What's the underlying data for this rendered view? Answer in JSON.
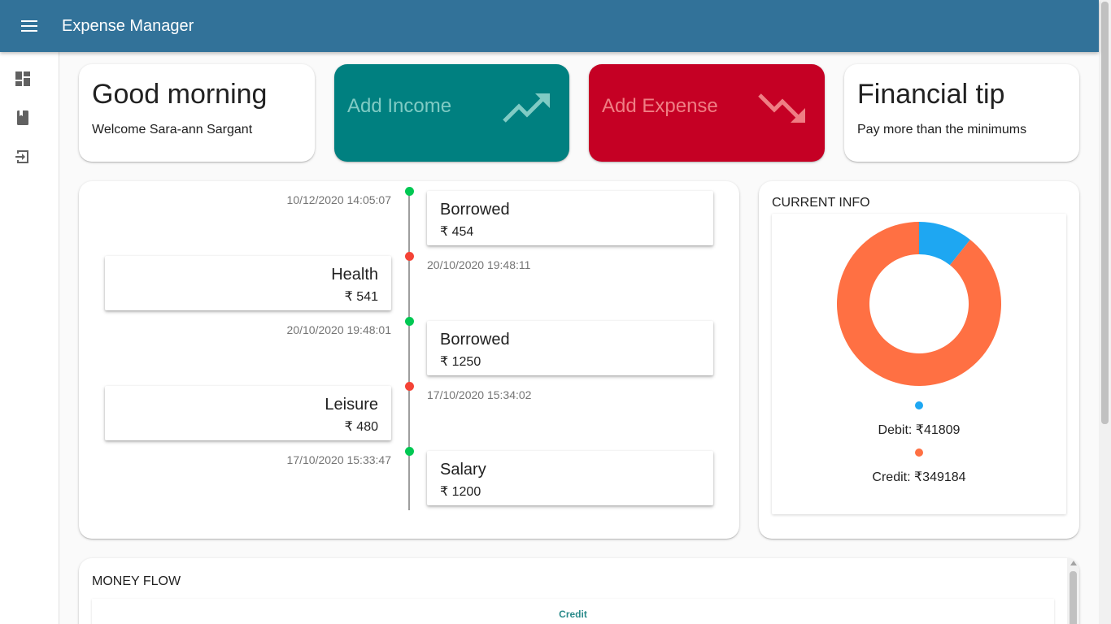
{
  "app": {
    "title": "Expense Manager"
  },
  "drawer": {
    "items": [
      {
        "icon": "dashboard-icon"
      },
      {
        "icon": "book-icon"
      },
      {
        "icon": "logout-icon"
      }
    ]
  },
  "greeting": {
    "title": "Good morning",
    "subtitle": "Welcome Sara-ann Sargant"
  },
  "actions": {
    "income": {
      "label": "Add Income",
      "icon": "trending-up-icon",
      "bg": "#008080",
      "fg": "#80cbc4"
    },
    "expense": {
      "label": "Add Expense",
      "icon": "trending-down-icon",
      "bg": "#c50024",
      "fg": "#ef7e84"
    }
  },
  "tip": {
    "title": "Financial tip",
    "text": "Pay more than the minimums"
  },
  "timeline": [
    {
      "date": "10/12/2020 14:05:07",
      "category": "Borrowed",
      "amount": "₹ 454",
      "type": "credit",
      "side": "right"
    },
    {
      "date": "20/10/2020 19:48:11",
      "category": "Health",
      "amount": "₹ 541",
      "type": "debit",
      "side": "left"
    },
    {
      "date": "20/10/2020 19:48:01",
      "category": "Borrowed",
      "amount": "₹ 1250",
      "type": "credit",
      "side": "right"
    },
    {
      "date": "17/10/2020 15:34:02",
      "category": "Leisure",
      "amount": "₹ 480",
      "type": "debit",
      "side": "left"
    },
    {
      "date": "17/10/2020 15:33:47",
      "category": "Salary",
      "amount": "₹ 1200",
      "type": "credit",
      "side": "right"
    }
  ],
  "colors": {
    "credit_dot": "#00c853",
    "debit_dot": "#f44336",
    "debit": "#1ea7f2",
    "credit": "#ff7043"
  },
  "current_info": {
    "title": "CURRENT INFO",
    "debit_label": "Debit: ₹41809",
    "credit_label": "Credit: ₹349184"
  },
  "chart_data": {
    "type": "pie",
    "labels": [
      "Debit",
      "Credit"
    ],
    "values": [
      41809,
      349184
    ],
    "colors": [
      "#1ea7f2",
      "#ff7043"
    ]
  },
  "money_flow": {
    "title": "MONEY FLOW",
    "legend": "Credit"
  }
}
